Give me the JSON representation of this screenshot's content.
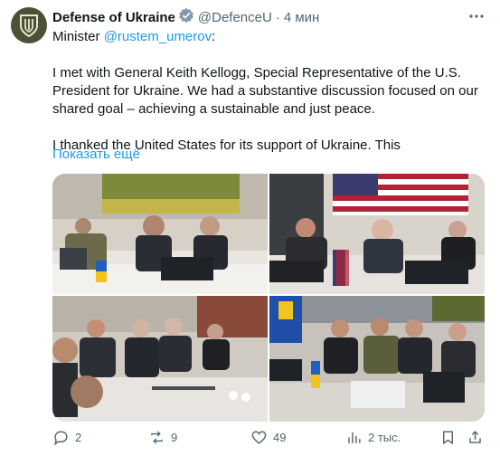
{
  "tweet": {
    "author_name": "Defense of Ukraine",
    "handle": "@DefenceU",
    "separator": "·",
    "time": "4 мин",
    "line1_prefix": "Minister ",
    "mention": "@rustem_umerov",
    "line1_suffix": ":",
    "paragraph1": "I met with General Keith Kellogg, Special Representative of the U.S. President for Ukraine. We had a substantive discussion focused on our shared goal – achieving a sustainable and just peace.",
    "paragraph2": "I thanked the United States for its support of Ukraine. This",
    "show_more": "Показать ещё"
  },
  "actions": {
    "replies": "2",
    "reposts": "9",
    "likes": "49",
    "views": "2 тыс."
  },
  "colors": {
    "link": "#1d9bf0",
    "muted": "#536471",
    "avatar_bg": "#4a5135"
  },
  "icons": [
    "avatar-emblem-icon",
    "verified-badge-icon",
    "more-options-icon",
    "reply-icon",
    "repost-icon",
    "like-icon",
    "views-icon",
    "bookmark-icon",
    "share-icon"
  ]
}
